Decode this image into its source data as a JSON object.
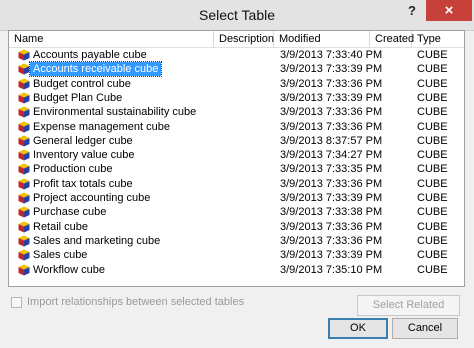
{
  "window": {
    "title": "Select Table",
    "help_label": "?",
    "close_label": "×"
  },
  "columns": {
    "name": "Name",
    "description": "Description",
    "modified": "Modified",
    "created": "Created",
    "type": "Type"
  },
  "icon": "cube-icon",
  "colors": {
    "selection": "#3399ff",
    "close": "#c7403a",
    "ok_border": "#3c7fb1"
  },
  "rows": [
    {
      "name": "Accounts payable cube",
      "modified": "3/9/2013 7:33:40 PM",
      "type": "CUBE",
      "selected": false
    },
    {
      "name": "Accounts receivable cube",
      "modified": "3/9/2013 7:33:39 PM",
      "type": "CUBE",
      "selected": true
    },
    {
      "name": "Budget control cube",
      "modified": "3/9/2013 7:33:36 PM",
      "type": "CUBE",
      "selected": false
    },
    {
      "name": "Budget Plan Cube",
      "modified": "3/9/2013 7:33:39 PM",
      "type": "CUBE",
      "selected": false
    },
    {
      "name": "Environmental sustainability cube",
      "modified": "3/9/2013 7:33:36 PM",
      "type": "CUBE",
      "selected": false
    },
    {
      "name": "Expense management cube",
      "modified": "3/9/2013 7:33:36 PM",
      "type": "CUBE",
      "selected": false
    },
    {
      "name": "General ledger cube",
      "modified": "3/9/2013 8:37:57 PM",
      "type": "CUBE",
      "selected": false
    },
    {
      "name": "Inventory value cube",
      "modified": "3/9/2013 7:34:27 PM",
      "type": "CUBE",
      "selected": false
    },
    {
      "name": "Production cube",
      "modified": "3/9/2013 7:33:35 PM",
      "type": "CUBE",
      "selected": false
    },
    {
      "name": "Profit tax totals cube",
      "modified": "3/9/2013 7:33:36 PM",
      "type": "CUBE",
      "selected": false
    },
    {
      "name": "Project accounting cube",
      "modified": "3/9/2013 7:33:39 PM",
      "type": "CUBE",
      "selected": false
    },
    {
      "name": "Purchase cube",
      "modified": "3/9/2013 7:33:38 PM",
      "type": "CUBE",
      "selected": false
    },
    {
      "name": "Retail cube",
      "modified": "3/9/2013 7:33:36 PM",
      "type": "CUBE",
      "selected": false
    },
    {
      "name": "Sales and marketing cube",
      "modified": "3/9/2013 7:33:36 PM",
      "type": "CUBE",
      "selected": false
    },
    {
      "name": "Sales cube",
      "modified": "3/9/2013 7:33:39 PM",
      "type": "CUBE",
      "selected": false
    },
    {
      "name": "Workflow cube",
      "modified": "3/9/2013 7:35:10 PM",
      "type": "CUBE",
      "selected": false
    }
  ],
  "footer": {
    "checkbox_label": "Import relationships between selected tables",
    "checkbox_checked": false,
    "related_button": "Select Related Tables",
    "ok_button": "OK",
    "cancel_button": "Cancel"
  }
}
